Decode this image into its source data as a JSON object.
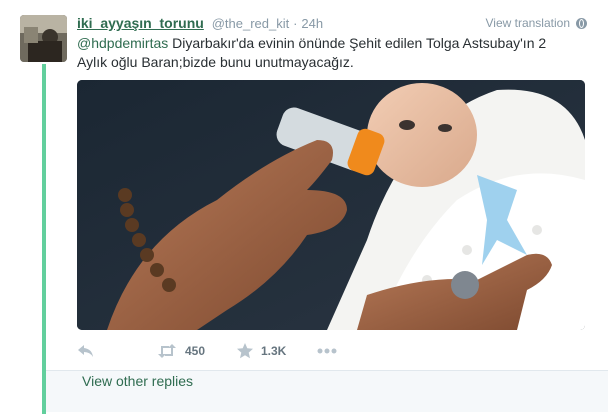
{
  "tweet": {
    "fullname": "iki_ayyaşın_torunu",
    "username": "@the_red_kit",
    "separator": "·",
    "time": "24h",
    "view_translation": "View translation",
    "mention": "@hdpdemirtas",
    "text": " Diyarbakır'da evinin önünde Şehit edilen Tolga Astsubay'ın 2 Aylık oğlu Baran;bizde bunu unutmayacağız.",
    "retweet_count": "450",
    "favorite_count": "1.3K"
  },
  "thread": {
    "view_other_replies": "View other replies"
  },
  "colors": {
    "accent": "#2f6c50",
    "thread_line": "#62cf9d",
    "muted": "#8899a6"
  },
  "icons": {
    "reply": "reply-icon",
    "retweet": "retweet-icon",
    "favorite": "star-icon",
    "more": "more-icon",
    "translate": "globe-icon"
  }
}
